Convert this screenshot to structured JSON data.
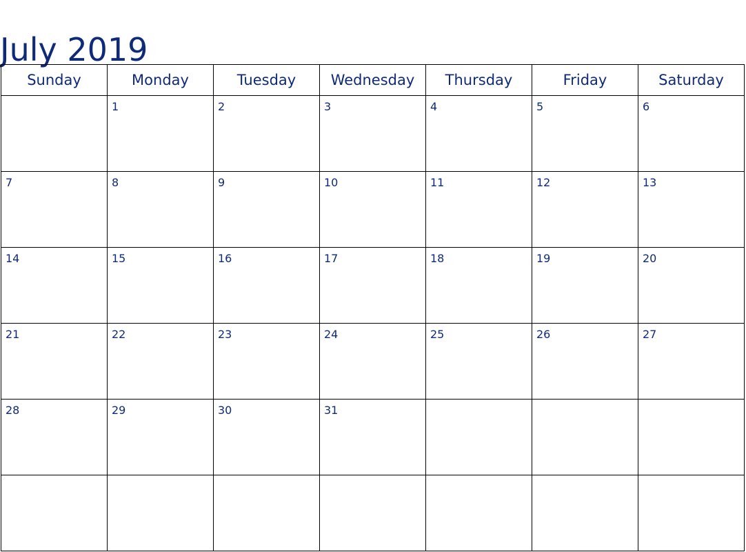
{
  "title": "July 2019",
  "weekdays": [
    "Sunday",
    "Monday",
    "Tuesday",
    "Wednesday",
    "Thursday",
    "Friday",
    "Saturday"
  ],
  "weeks": [
    [
      "",
      "1",
      "2",
      "3",
      "4",
      "5",
      "6"
    ],
    [
      "7",
      "8",
      "9",
      "10",
      "11",
      "12",
      "13"
    ],
    [
      "14",
      "15",
      "16",
      "17",
      "18",
      "19",
      "20"
    ],
    [
      "21",
      "22",
      "23",
      "24",
      "25",
      "26",
      "27"
    ],
    [
      "28",
      "29",
      "30",
      "31",
      "",
      "",
      ""
    ],
    [
      "",
      "",
      "",
      "",
      "",
      "",
      ""
    ]
  ]
}
